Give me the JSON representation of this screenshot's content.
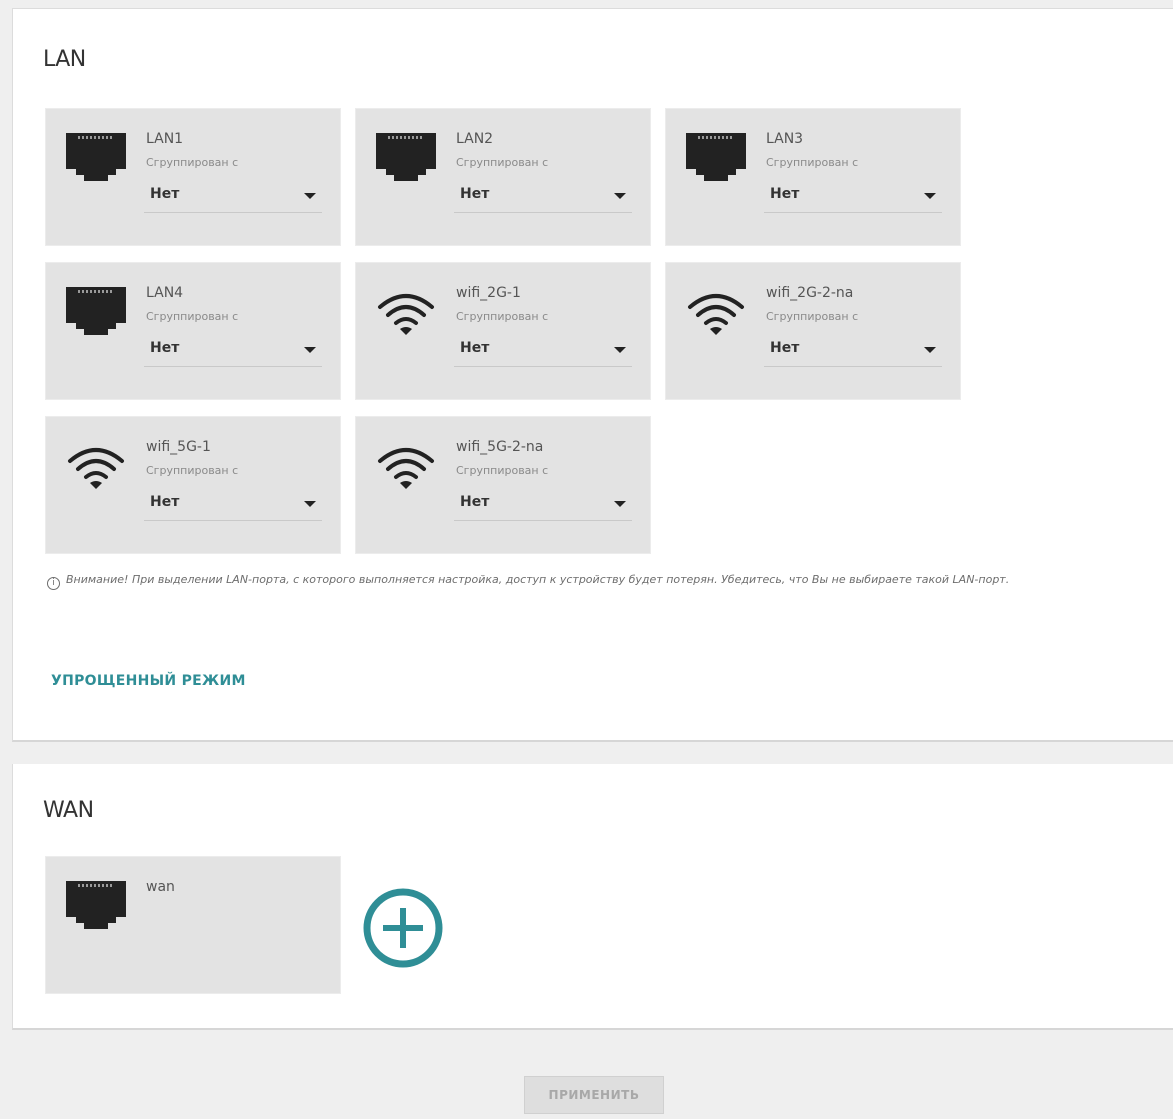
{
  "lan": {
    "title": "LAN",
    "grouped_label": "Сгруппирован с",
    "ports": [
      {
        "name": "LAN1",
        "icon": "ethernet-port-icon",
        "value": "Нет"
      },
      {
        "name": "LAN2",
        "icon": "ethernet-port-icon",
        "value": "Нет"
      },
      {
        "name": "LAN3",
        "icon": "ethernet-port-icon",
        "value": "Нет"
      },
      {
        "name": "LAN4",
        "icon": "ethernet-port-icon",
        "value": "Нет"
      },
      {
        "name": "wifi_2G-1",
        "icon": "wifi-icon",
        "value": "Нет"
      },
      {
        "name": "wifi_2G-2-na",
        "icon": "wifi-icon",
        "value": "Нет"
      },
      {
        "name": "wifi_5G-1",
        "icon": "wifi-icon",
        "value": "Нет"
      },
      {
        "name": "wifi_5G-2-na",
        "icon": "wifi-icon",
        "value": "Нет"
      }
    ],
    "warning": "Внимание! При выделении LAN-порта, с которого выполняется настройка, доступ к устройству будет потерян. Убедитесь, что Вы не выбираете такой LAN-порт.",
    "info_icon": "i",
    "simple_mode_link": "УПРОЩЕННЫЙ РЕЖИМ"
  },
  "wan": {
    "title": "WAN",
    "ports": [
      {
        "name": "wan",
        "icon": "ethernet-port-icon"
      }
    ],
    "add_icon": "plus-circle-icon"
  },
  "footer": {
    "apply_label": "ПРИМЕНИТЬ"
  },
  "colors": {
    "accent": "#2f8e96",
    "card_bg": "#e3e3e3",
    "icon_dark": "#222222"
  }
}
